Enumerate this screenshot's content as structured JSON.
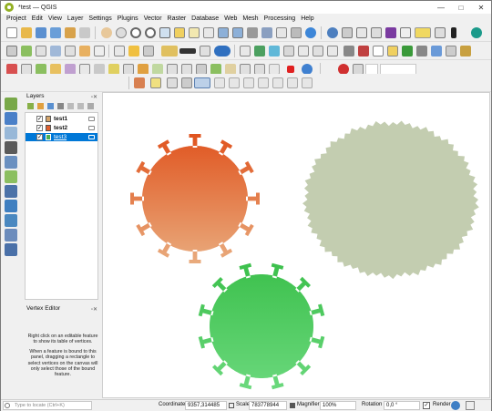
{
  "window": {
    "title": "*test — QGIS",
    "controls": [
      "—",
      "□",
      "✕"
    ]
  },
  "menu": [
    "Project",
    "Edit",
    "View",
    "Layer",
    "Settings",
    "Plugins",
    "Vector",
    "Raster",
    "Database",
    "Web",
    "Mesh",
    "Processing",
    "Help"
  ],
  "layers_panel": {
    "title": "Layers",
    "layers": [
      {
        "name": "test1",
        "checked": true,
        "color": "#d4a46a",
        "selected": false
      },
      {
        "name": "test2",
        "checked": true,
        "color": "#e06030",
        "selected": false
      },
      {
        "name": "test3",
        "checked": true,
        "color": "#4caf50",
        "selected": true
      }
    ]
  },
  "vertex_editor": {
    "title": "Vertex Editor",
    "text1": "Right click on an editable feature to show its table of vertices.",
    "text2": "When a feature is bound to this panel, dragging a rectangle to select vertices on the canvas will only select those of the bound feature."
  },
  "statusbar": {
    "locator_placeholder": "Type to locate (Ctrl+K)",
    "coordinate_label": "Coordinate",
    "coordinate_value": "9357,314485",
    "scale_label": "Scale",
    "scale_value": "783778944",
    "magnifier_label": "Magnifier",
    "magnifier_value": "100%",
    "rotation_label": "Rotation",
    "rotation_value": "0,0 °",
    "render_label": "Render"
  },
  "colors": {
    "orange_top": "#e0541f",
    "orange_bottom": "#e8a878",
    "sage": "#c3cdb0",
    "green_top": "#3fc24f",
    "green_bottom": "#66d67a",
    "selection": "#0078d7"
  }
}
